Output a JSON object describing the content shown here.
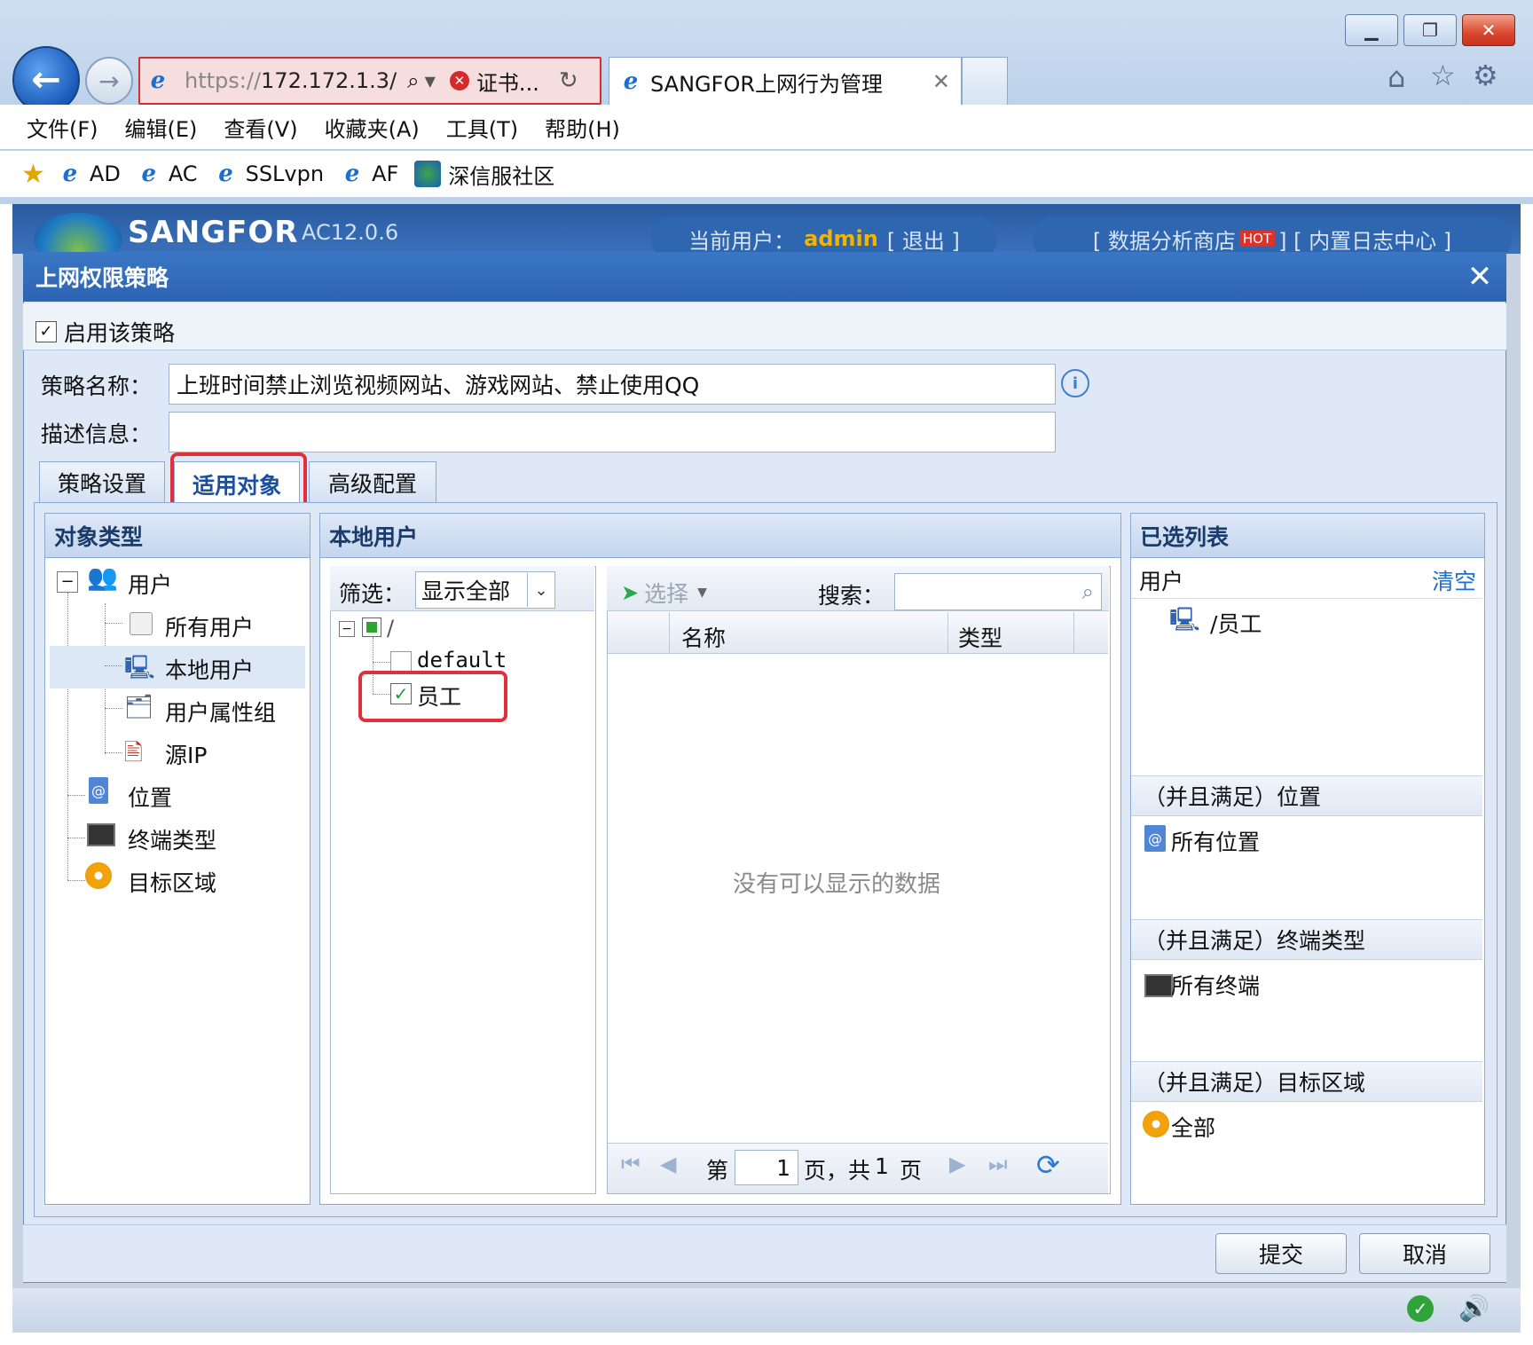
{
  "browser": {
    "address_prefix": "https://",
    "address_host": "172.172.1.3/",
    "cert_label": "证书...",
    "tab_title": "SANGFOR上网行为管理",
    "menu": [
      "文件(F)",
      "编辑(E)",
      "查看(V)",
      "收藏夹(A)",
      "工具(T)",
      "帮助(H)"
    ],
    "favorites": [
      "AD",
      "AC",
      "SSLvpn",
      "AF",
      "深信服社区"
    ]
  },
  "app_header": {
    "logo": "SANGFOR",
    "version": "AC12.0.6",
    "current_user_label": "当前用户：",
    "current_user": "admin",
    "logout": "[ 退出 ]",
    "data_store": "[ 数据分析商店",
    "hot_badge": "HOT",
    "log_center": "] [ 内置日志中心 ]"
  },
  "dialog": {
    "title": "上网权限策略",
    "enable_label": "启用该策略",
    "enable_checked": "✓",
    "name_label": "策略名称：",
    "name_value": "上班时间禁止浏览视频网站、游戏网站、禁止使用QQ",
    "desc_label": "描述信息：",
    "desc_value": "",
    "tabs": [
      "策略设置",
      "适用对象",
      "高级配置"
    ],
    "submit": "提交",
    "cancel": "取消"
  },
  "object_type": {
    "header": "对象类型",
    "user": "用户",
    "all_users": "所有用户",
    "local_users": "本地用户",
    "user_attr_group": "用户属性组",
    "source_ip": "源IP",
    "location": "位置",
    "terminal_type": "终端类型",
    "target_area": "目标区域"
  },
  "local_user": {
    "header": "本地用户",
    "filter_label": "筛选：",
    "filter_value": "显示全部",
    "root": "/",
    "default_group": "default",
    "employee_group": "员工",
    "select_btn": "选择",
    "search_label": "搜索：",
    "col_name": "名称",
    "col_type": "类型",
    "empty_text": "没有可以显示的数据",
    "page_prefix": "第",
    "page_current": "1",
    "page_mid": "页，共",
    "page_total": "1",
    "page_suffix": "页"
  },
  "selected": {
    "header": "已选列表",
    "user_label": "用户",
    "clear": "清空",
    "user_item": "/员工",
    "loc_section": "（并且满足）位置",
    "loc_item": "所有位置",
    "term_section": "（并且满足）终端类型",
    "term_item": "所有终端",
    "area_section": "（并且满足）目标区域",
    "area_item": "全部"
  }
}
